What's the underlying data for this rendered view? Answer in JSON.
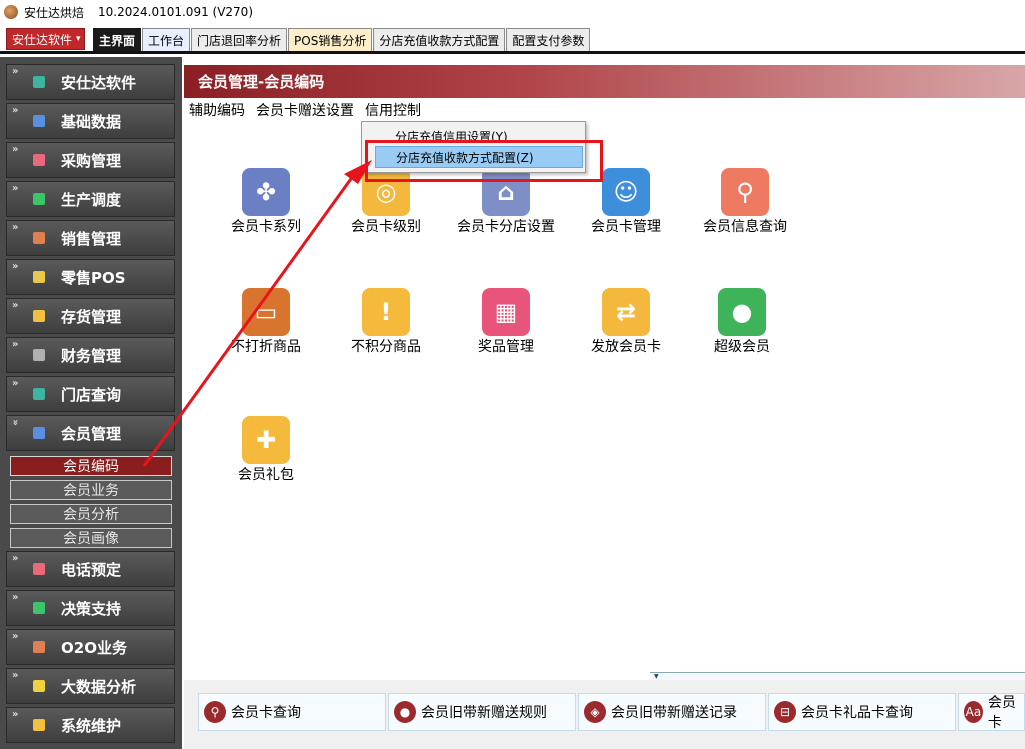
{
  "window": {
    "app_name": "安仕达烘焙",
    "version": "10.2024.0101.091 (V270)"
  },
  "toolbar": {
    "brand_label": "安仕达软件",
    "tabs": [
      "主界面",
      "工作台",
      "门店退回率分析",
      "POS销售分析",
      "分店充值收款方式配置",
      "配置支付参数"
    ]
  },
  "sidebar": {
    "items": [
      {
        "label": "安仕达软件",
        "color": "#3db4a0"
      },
      {
        "label": "基础数据",
        "color": "#5b8fe0"
      },
      {
        "label": "采购管理",
        "color": "#e86a7a"
      },
      {
        "label": "生产调度",
        "color": "#3cc46a"
      },
      {
        "label": "销售管理",
        "color": "#e08050"
      },
      {
        "label": "零售POS",
        "color": "#e8c84a"
      },
      {
        "label": "存货管理",
        "color": "#f0c040"
      },
      {
        "label": "财务管理",
        "color": "#b0b0b0"
      },
      {
        "label": "门店查询",
        "color": "#3db4a0"
      },
      {
        "label": "会员管理",
        "color": "#5b8fe0"
      },
      {
        "label": "电话预定",
        "color": "#e86a7a"
      },
      {
        "label": "决策支持",
        "color": "#3cc46a"
      },
      {
        "label": "O2O业务",
        "color": "#e08050"
      },
      {
        "label": "大数据分析",
        "color": "#f0d040"
      },
      {
        "label": "系统维护",
        "color": "#f0c040"
      }
    ],
    "sub_items": [
      "会员编码",
      "会员业务",
      "会员分析",
      "会员画像"
    ]
  },
  "content": {
    "header_title": "会员管理-会员编码",
    "menu": [
      "辅助编码",
      "会员卡赠送设置",
      "信用控制"
    ],
    "dropdown": [
      "分店充值信用设置(Y)",
      "分店充值收款方式配置(Z)"
    ],
    "grid": [
      {
        "label": "会员卡系列",
        "color": "#6b7fc4",
        "glyph": "✤"
      },
      {
        "label": "会员卡级别",
        "color": "#f3b83c",
        "glyph": "◎"
      },
      {
        "label": "会员卡分店设置",
        "color": "#7e8fc8",
        "glyph": "⌂"
      },
      {
        "label": "会员卡管理",
        "color": "#3d8fdc",
        "glyph": "☺"
      },
      {
        "label": "会员信息查询",
        "color": "#ee7a62",
        "glyph": "⚲"
      },
      {
        "label": "不打折商品",
        "color": "#d8742e",
        "glyph": "▭"
      },
      {
        "label": "不积分商品",
        "color": "#f5b93c",
        "glyph": "!"
      },
      {
        "label": "奖品管理",
        "color": "#e9557a",
        "glyph": "▦"
      },
      {
        "label": "发放会员卡",
        "color": "#f3b83c",
        "glyph": "⇄"
      },
      {
        "label": "超级会员",
        "color": "#3fb35a",
        "glyph": "●"
      },
      {
        "label": "会员礼包",
        "color": "#f5b93c",
        "glyph": "✚"
      }
    ],
    "bottom_buttons": [
      "会员卡查询",
      "会员旧带新赠送规则",
      "会员旧带新赠送记录",
      "会员卡礼品卡查询",
      "会员卡"
    ]
  }
}
